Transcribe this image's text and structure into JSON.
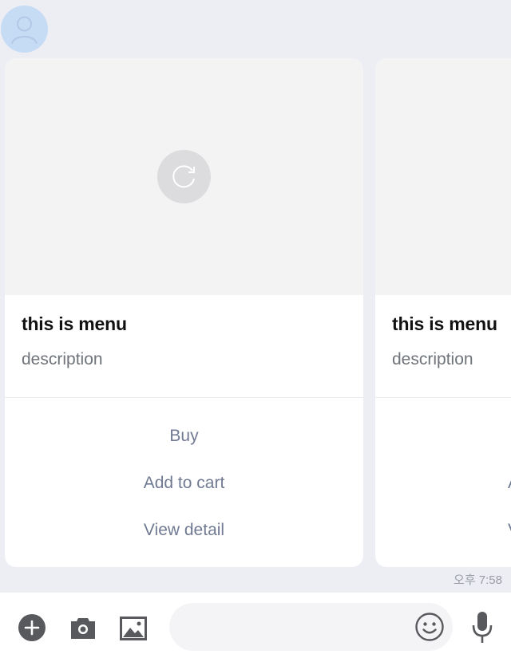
{
  "colors": {
    "background": "#eceef4",
    "card": "#ffffff",
    "image_placeholder": "#f3f3f4",
    "avatar": "#c6dbf4",
    "action_text": "#707a92",
    "icon": "#58595d"
  },
  "avatar": {
    "icon": "person-silhouette-icon"
  },
  "cards": [
    {
      "image_icon": "reload-icon",
      "title": "this is menu",
      "description": "description",
      "actions": [
        "Buy",
        "Add to cart",
        "View detail"
      ]
    },
    {
      "title": "this is menu",
      "description": "description",
      "actions": [
        "",
        "A",
        "V"
      ]
    }
  ],
  "timestamp": "오후 7:58",
  "input_bar": {
    "icons": [
      "plus-circle-icon",
      "camera-icon",
      "image-icon",
      "emoji-icon",
      "mic-icon"
    ],
    "message_placeholder": ""
  }
}
